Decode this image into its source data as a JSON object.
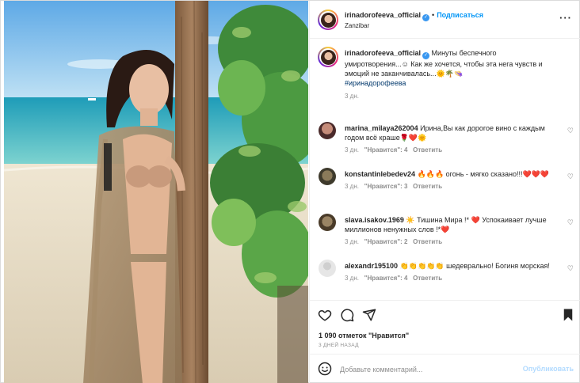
{
  "post": {
    "author": "irinadorofeeva_official",
    "follow_label": "Подписаться",
    "dot": "•",
    "location": "Zanzibar",
    "more_label": "···"
  },
  "caption": {
    "author": "irinadorofeeva_official",
    "text": "Минуты беспечного умиротворения...☺ Как же хочется, чтобы эта нега чувств и эмоций не заканчивалась...🌞🌴👒",
    "hashtag": "#иринадорофеева",
    "time": "3 дн."
  },
  "comments": [
    {
      "author": "marina_milaya262004",
      "text": "Ирина,Вы как дорогое вино с каждым годом всё краше🌹❤️🌞",
      "time": "3 дн.",
      "likes": "\"Нравится\": 4",
      "reply": "Ответить"
    },
    {
      "author": "konstantinlebedev24",
      "text": "🔥🔥🔥 огонь - мягко сказано!!!❤️❤️❤️",
      "time": "3 дн.",
      "likes": "\"Нравится\": 3",
      "reply": "Ответить"
    },
    {
      "author": "slava.isakov.1969",
      "text": "☀️ Тишина Мира !* ❤️ Успокаивает лучше миллионов ненужных слов !*❤️",
      "time": "3 дн.",
      "likes": "\"Нравится\": 2",
      "reply": "Ответить"
    },
    {
      "author": "alexandr195100",
      "text": "👏👏👏👏👏 шедеврально! Богиня морская!",
      "time": "3 дн.",
      "likes": "\"Нравится\": 4",
      "reply": "Ответить"
    }
  ],
  "stats": {
    "likes": "1 090 отметок \"Нравится\"",
    "posted": "3 ДНЕЙ НАЗАД"
  },
  "compose": {
    "placeholder": "Добавьте комментарий...",
    "publish_label": "Опубликовать"
  },
  "icons": {
    "like": "heart-icon",
    "comment": "comment-icon",
    "share": "paper-plane-icon",
    "save": "bookmark-icon",
    "emoji": "smiley-icon",
    "verified": "verified-badge-icon"
  },
  "colors": {
    "accent": "#0095f6",
    "hashtag": "#00376b",
    "muted": "#8e8e8e",
    "verified": "#3897f0"
  }
}
